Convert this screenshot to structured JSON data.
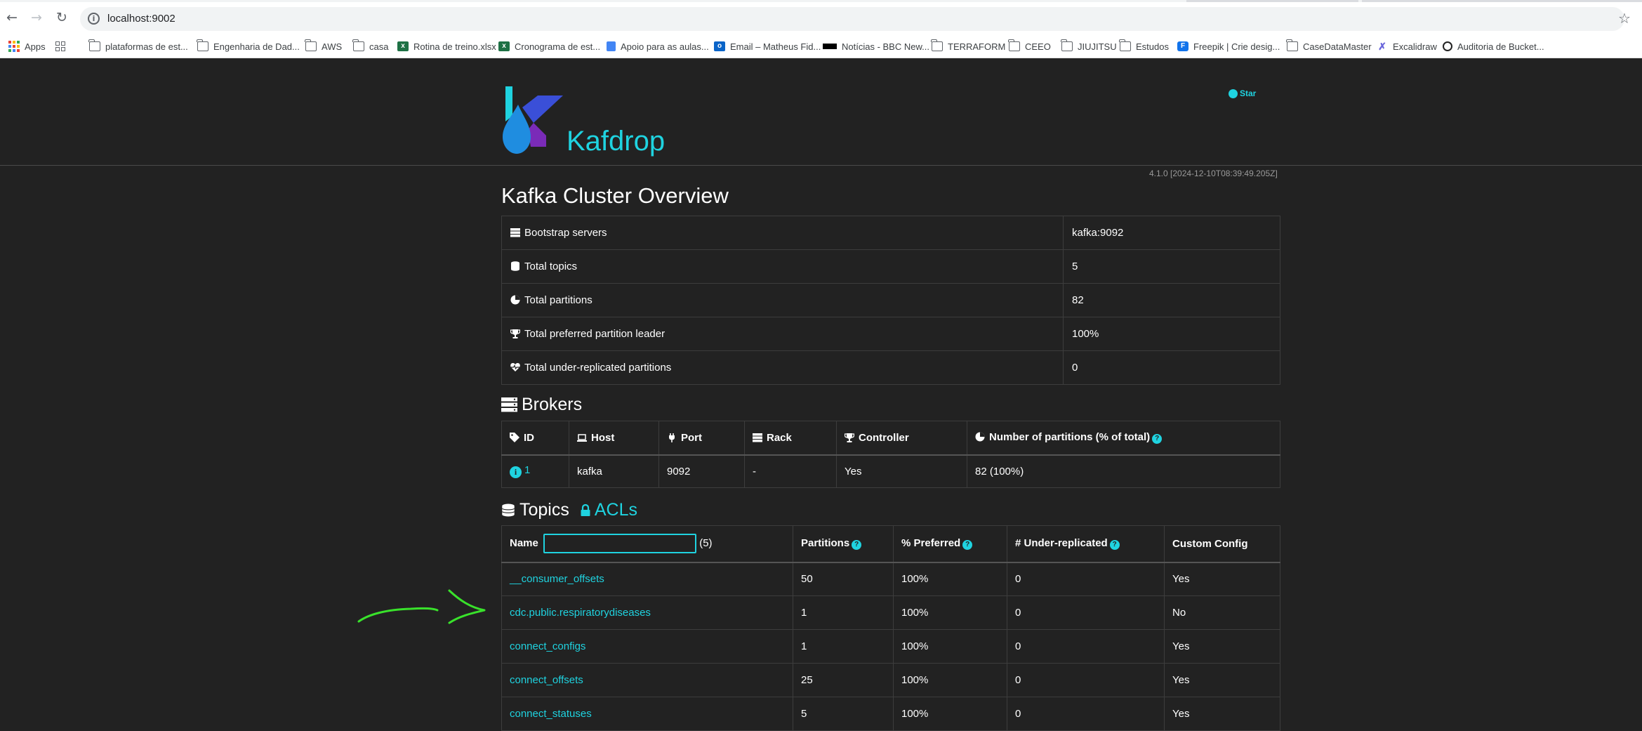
{
  "browser": {
    "url": "localhost:9002",
    "bookmarks": [
      {
        "label": "Apps",
        "icon": "apps-grid-icon"
      },
      {
        "label": "",
        "icon": "tab-groups-icon"
      },
      {
        "label": "plataformas de est...",
        "icon": "folder-icon"
      },
      {
        "label": "Engenharia de Dad...",
        "icon": "folder-icon"
      },
      {
        "label": "AWS",
        "icon": "folder-icon"
      },
      {
        "label": "casa",
        "icon": "folder-icon"
      },
      {
        "label": "Rotina de treino.xlsx",
        "icon": "excel-icon"
      },
      {
        "label": "Cronograma de est...",
        "icon": "excel-icon"
      },
      {
        "label": "Apoio para as aulas...",
        "icon": "google-docs-icon"
      },
      {
        "label": "Email – Matheus Fid...",
        "icon": "outlook-icon"
      },
      {
        "label": "Notícias - BBC New...",
        "icon": "bbc-icon"
      },
      {
        "label": "TERRAFORM",
        "icon": "folder-icon"
      },
      {
        "label": "CEEO",
        "icon": "folder-icon"
      },
      {
        "label": "JIUJITSU",
        "icon": "folder-icon"
      },
      {
        "label": "Estudos",
        "icon": "folder-icon"
      },
      {
        "label": "Freepik | Crie desig...",
        "icon": "freepik-icon"
      },
      {
        "label": "CaseDataMaster",
        "icon": "folder-icon"
      },
      {
        "label": "Excalidraw",
        "icon": "excalidraw-icon"
      },
      {
        "label": "Auditoria de Bucket...",
        "icon": "audit-icon"
      }
    ]
  },
  "header": {
    "brand": "Kafdrop",
    "star_label": "Star",
    "version": "4.1.0 [2024-12-10T08:39:49.205Z]"
  },
  "overview": {
    "title": "Kafka Cluster Overview",
    "rows": [
      {
        "label": "Bootstrap servers",
        "value": "kafka:9092",
        "icon": "server-icon"
      },
      {
        "label": "Total topics",
        "value": "5",
        "icon": "database-icon"
      },
      {
        "label": "Total partitions",
        "value": "82",
        "icon": "pie-chart-icon"
      },
      {
        "label": "Total preferred partition leader",
        "value": "100%",
        "icon": "trophy-icon"
      },
      {
        "label": "Total under-replicated partitions",
        "value": "0",
        "icon": "heartbeat-icon"
      }
    ]
  },
  "brokers": {
    "title": "Brokers",
    "headers": [
      "ID",
      "Host",
      "Port",
      "Rack",
      "Controller",
      "Number of partitions (% of total)"
    ],
    "rows": [
      {
        "id": "1",
        "host": "kafka",
        "port": "9092",
        "rack": "-",
        "controller": "Yes",
        "partitions": "82 (100%)"
      }
    ]
  },
  "topics": {
    "title": "Topics",
    "acl_label": "ACLs",
    "filter_value": "",
    "count_label": "(5)",
    "headers": [
      "Name",
      "Partitions",
      "% Preferred",
      "# Under-replicated",
      "Custom Config"
    ],
    "rows": [
      {
        "name": "__consumer_offsets",
        "partitions": "50",
        "preferred": "100%",
        "under_replicated": "0",
        "custom_config": "Yes"
      },
      {
        "name": "cdc.public.respiratorydiseases",
        "partitions": "1",
        "preferred": "100%",
        "under_replicated": "0",
        "custom_config": "No"
      },
      {
        "name": "connect_configs",
        "partitions": "1",
        "preferred": "100%",
        "under_replicated": "0",
        "custom_config": "Yes"
      },
      {
        "name": "connect_offsets",
        "partitions": "25",
        "preferred": "100%",
        "under_replicated": "0",
        "custom_config": "Yes"
      },
      {
        "name": "connect_statuses",
        "partitions": "5",
        "preferred": "100%",
        "under_replicated": "0",
        "custom_config": "Yes"
      }
    ]
  },
  "colors": {
    "accent": "#1fd3e0",
    "background": "#222222",
    "annotation": "#39e22b"
  }
}
